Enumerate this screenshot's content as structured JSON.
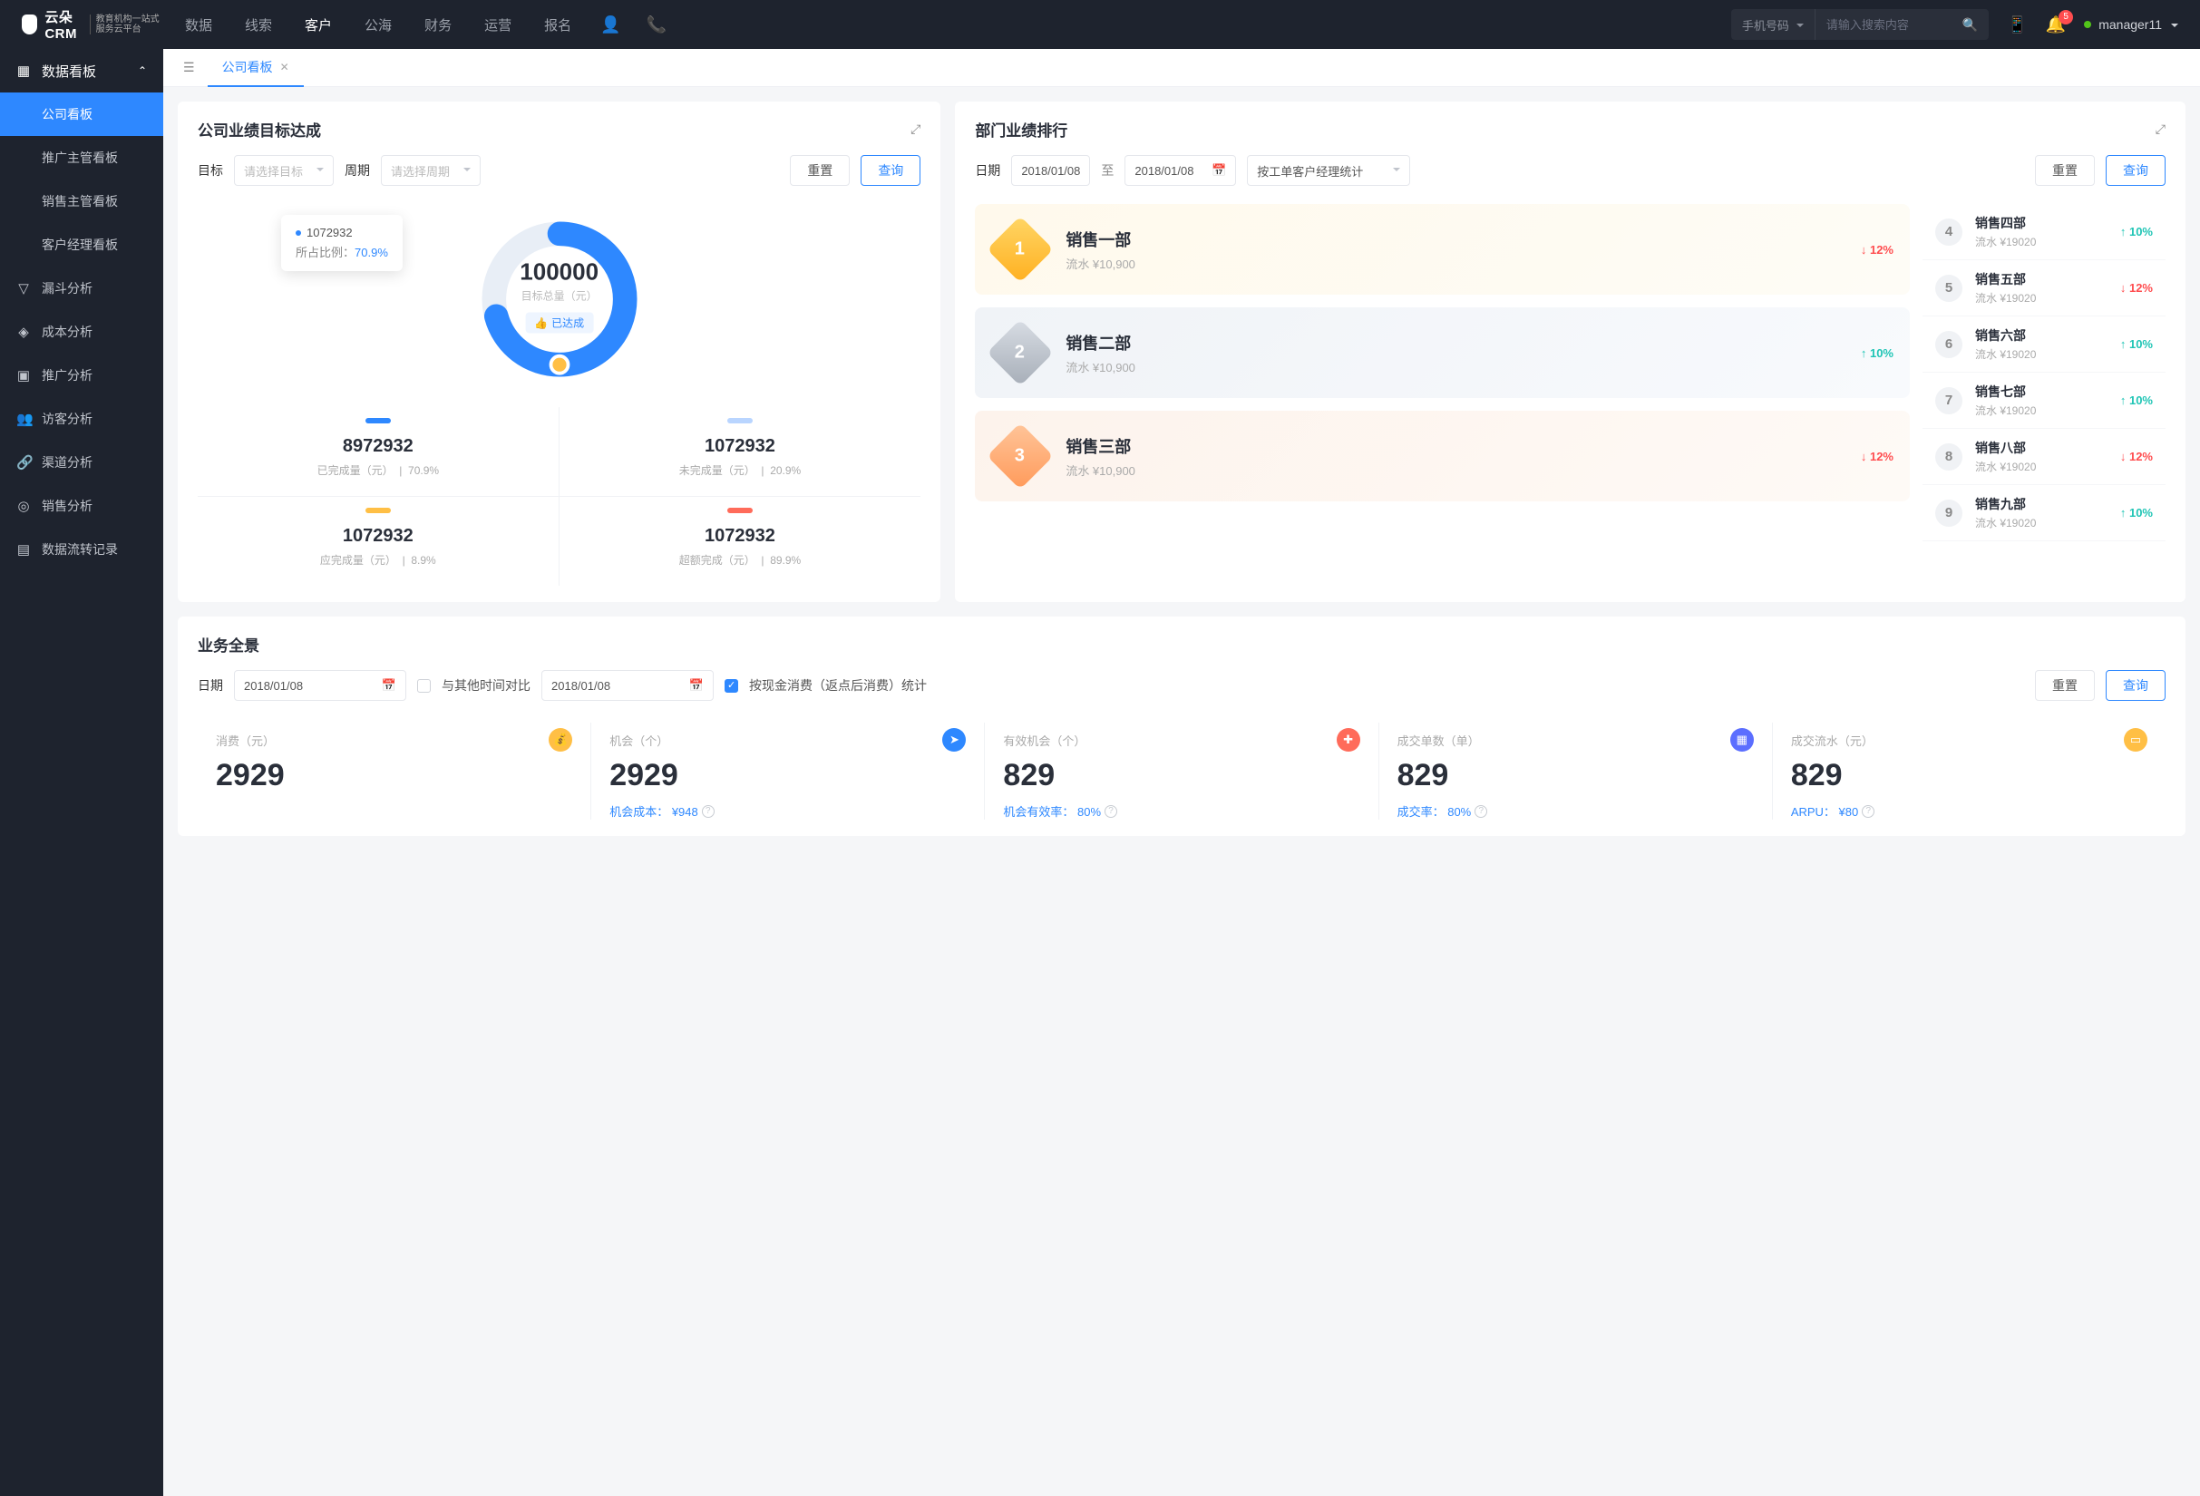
{
  "header": {
    "logo_text": "云朵CRM",
    "logo_sub": "教育机构一站式服务云平台",
    "nav": [
      "数据",
      "线索",
      "客户",
      "公海",
      "财务",
      "运营",
      "报名"
    ],
    "nav_active": 2,
    "search_type": "手机号码",
    "search_placeholder": "请输入搜索内容",
    "notif_count": "5",
    "user": "manager11"
  },
  "sidebar": {
    "header": "数据看板",
    "children": [
      "公司看板",
      "推广主管看板",
      "销售主管看板",
      "客户经理看板"
    ],
    "active_index": 0,
    "items": [
      "漏斗分析",
      "成本分析",
      "推广分析",
      "访客分析",
      "渠道分析",
      "销售分析",
      "数据流转记录"
    ]
  },
  "tabs": {
    "active": "公司看板"
  },
  "goal_panel": {
    "title": "公司业绩目标达成",
    "target_label": "目标",
    "target_placeholder": "请选择目标",
    "period_label": "周期",
    "period_placeholder": "请选择周期",
    "reset_btn": "重置",
    "query_btn": "查询",
    "chart_data": {
      "type": "donut",
      "center_value": "100000",
      "center_label": "目标总量（元）",
      "center_badge": "已达成",
      "tooltip_value": "1072932",
      "tooltip_ratio_label": "所占比例：",
      "tooltip_ratio": "70.9%"
    },
    "stats": [
      {
        "color": "#2e88ff",
        "value": "8972932",
        "label": "已完成量（元）",
        "pct": "70.9%"
      },
      {
        "color": "#b9d5ff",
        "value": "1072932",
        "label": "未完成量（元）",
        "pct": "20.9%"
      },
      {
        "color": "#ffbf45",
        "value": "1072932",
        "label": "应完成量（元）",
        "pct": "8.9%"
      },
      {
        "color": "#ff6b5a",
        "value": "1072932",
        "label": "超额完成（元）",
        "pct": "89.9%"
      }
    ]
  },
  "rank_panel": {
    "title": "部门业绩排行",
    "date_label": "日期",
    "date1": "2018/01/08",
    "date_to": "至",
    "date2": "2018/01/08",
    "stat_select": "按工单客户经理统计",
    "reset_btn": "重置",
    "query_btn": "查询",
    "top3": [
      {
        "rank": "1",
        "name": "销售一部",
        "sub": "流水 ¥10,900",
        "pct": "12%",
        "dir": "down"
      },
      {
        "rank": "2",
        "name": "销售二部",
        "sub": "流水 ¥10,900",
        "pct": "10%",
        "dir": "up"
      },
      {
        "rank": "3",
        "name": "销售三部",
        "sub": "流水 ¥10,900",
        "pct": "12%",
        "dir": "down"
      }
    ],
    "rest": [
      {
        "rank": "4",
        "name": "销售四部",
        "sub": "流水 ¥19020",
        "pct": "10%",
        "dir": "up"
      },
      {
        "rank": "5",
        "name": "销售五部",
        "sub": "流水 ¥19020",
        "pct": "12%",
        "dir": "down"
      },
      {
        "rank": "6",
        "name": "销售六部",
        "sub": "流水 ¥19020",
        "pct": "10%",
        "dir": "up"
      },
      {
        "rank": "7",
        "name": "销售七部",
        "sub": "流水 ¥19020",
        "pct": "10%",
        "dir": "up"
      },
      {
        "rank": "8",
        "name": "销售八部",
        "sub": "流水 ¥19020",
        "pct": "12%",
        "dir": "down"
      },
      {
        "rank": "9",
        "name": "销售九部",
        "sub": "流水 ¥19020",
        "pct": "10%",
        "dir": "up"
      }
    ]
  },
  "pano_panel": {
    "title": "业务全景",
    "date_label": "日期",
    "date1": "2018/01/08",
    "compare_label": "与其他时间对比",
    "date2": "2018/01/08",
    "cash_label": "按现金消费（返点后消费）统计",
    "reset_btn": "重置",
    "query_btn": "查询",
    "kpis": [
      {
        "title": "消费（元）",
        "value": "2929",
        "sub": "",
        "icon": "💰",
        "icon_bg": "#ffbf45"
      },
      {
        "title": "机会（个）",
        "value": "2929",
        "sub": "机会成本： ¥948",
        "icon": "➤",
        "icon_bg": "#2e88ff"
      },
      {
        "title": "有效机会（个）",
        "value": "829",
        "sub": "机会有效率： 80%",
        "icon": "✚",
        "icon_bg": "#ff6b5a"
      },
      {
        "title": "成交单数（单）",
        "value": "829",
        "sub": "成交率： 80%",
        "icon": "▦",
        "icon_bg": "#5b6eff"
      },
      {
        "title": "成交流水（元）",
        "value": "829",
        "sub": "ARPU： ¥80",
        "icon": "▭",
        "icon_bg": "#ffbf45"
      }
    ]
  }
}
